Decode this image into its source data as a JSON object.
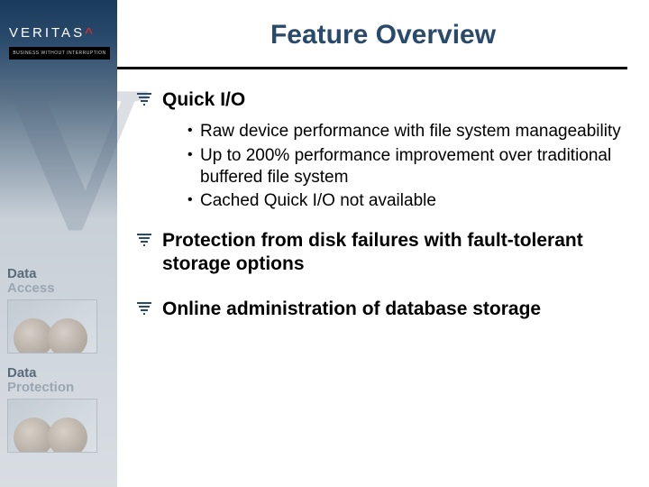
{
  "brand": {
    "name": "VERITAS",
    "tagline": "BUSINESS WITHOUT INTERRUPTION"
  },
  "sidebar": {
    "cards": [
      {
        "line1": "Data",
        "line2": "Access"
      },
      {
        "line1": "Data",
        "line2": "Protection"
      }
    ]
  },
  "slide": {
    "title": "Feature Overview",
    "bullets": [
      {
        "text": "Quick I/O",
        "subs": [
          "Raw device performance with file system manageability",
          "Up to 200% performance improvement over traditional buffered file system",
          "Cached Quick I/O not available"
        ]
      },
      {
        "text": "Protection from disk failures with fault-tolerant storage options",
        "subs": []
      },
      {
        "text": "Online administration of database storage",
        "subs": []
      }
    ]
  }
}
